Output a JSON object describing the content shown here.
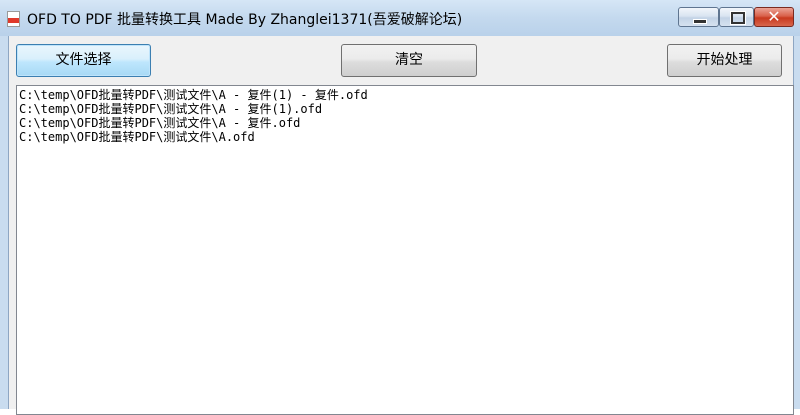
{
  "window": {
    "title": "OFD TO PDF 批量转换工具  Made By Zhanglei1371(吾爱破解论坛)",
    "icon": "pdf-file-icon"
  },
  "titlebar_buttons": {
    "minimize": "minimize-icon",
    "maximize": "maximize-icon",
    "close": "close-icon",
    "close_glyph": "✕"
  },
  "toolbar": {
    "select_label": "文件选择",
    "clear_label": "清空",
    "start_label": "开始处理"
  },
  "file_list": {
    "items": [
      "C:\\temp\\OFD批量转PDF\\测试文件\\A - 复件(1) - 复件.ofd",
      "C:\\temp\\OFD批量转PDF\\测试文件\\A - 复件(1).ofd",
      "C:\\temp\\OFD批量转PDF\\测试文件\\A - 复件.ofd",
      "C:\\temp\\OFD批量转PDF\\测试文件\\A.ofd"
    ]
  },
  "colors": {
    "accent": "#3c7fb1",
    "close_red": "#c8391f",
    "frame": "#c9dcef"
  }
}
